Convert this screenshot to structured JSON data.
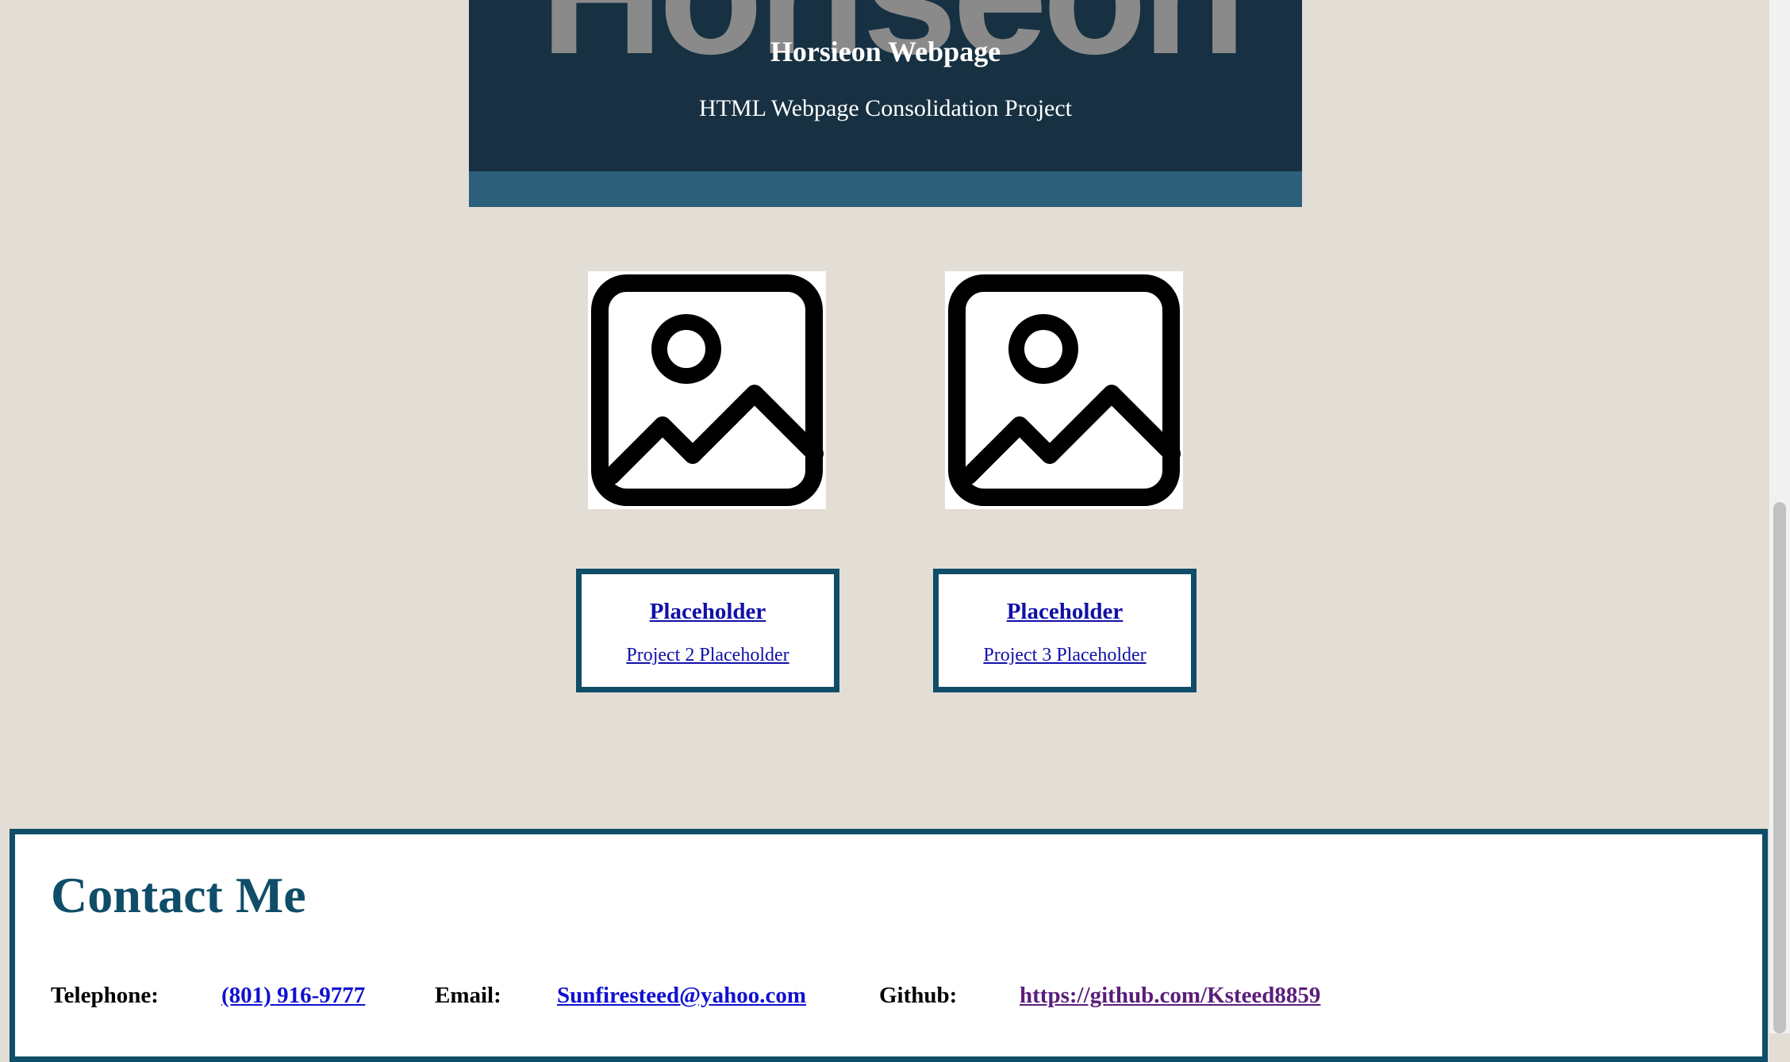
{
  "hero": {
    "watermark": "Horiseon",
    "title": "Horsieon Webpage",
    "subtitle": "HTML Webpage Consolidation Project"
  },
  "projects": [
    {
      "title": "Placeholder",
      "subtitle": "Project 2 Placeholder",
      "icon": "image-placeholder-icon"
    },
    {
      "title": "Placeholder",
      "subtitle": "Project 3 Placeholder",
      "icon": "image-placeholder-icon"
    }
  ],
  "contact": {
    "heading": "Contact Me",
    "telephone_label": "Telephone:",
    "telephone_value": "(801) 916-9777",
    "email_label": "Email:",
    "email_value": "Sunfiresteed@yahoo.com",
    "github_label": "Github:",
    "github_value": "https://github.com/Ksteed8859"
  },
  "colors": {
    "page_background": "#e3ded5",
    "hero_background": "#173142",
    "hero_bar": "#2c5f7a",
    "accent": "#0f4d69",
    "link": "#1010d0",
    "visited_link": "#5a1e7a"
  }
}
